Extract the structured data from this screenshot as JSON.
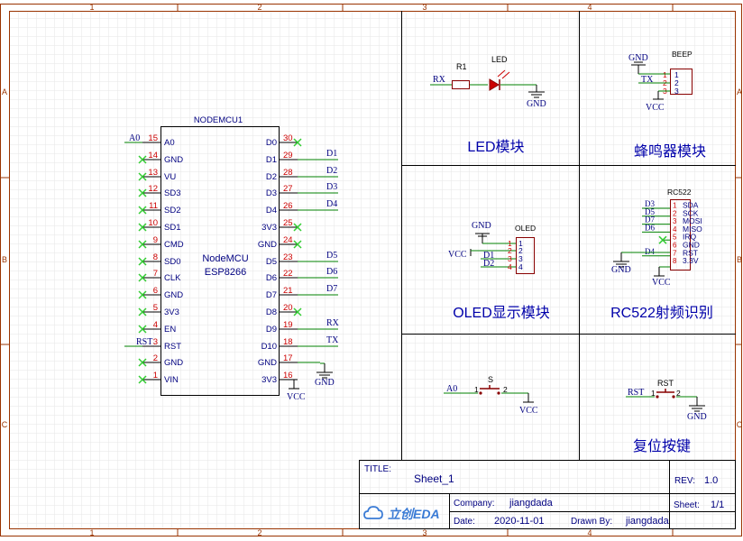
{
  "frame": {
    "cols": [
      "1",
      "2",
      "3",
      "4"
    ],
    "rows": [
      "A",
      "B",
      "C"
    ]
  },
  "sections": {
    "led": "LED模块",
    "buzzer": "蜂鸣器模块",
    "oled": "OLED显示模块",
    "rc522": "RC522射频识别",
    "reset": "复位按键"
  },
  "mcu": {
    "ref": "NODEMCU1",
    "name1": "NodeMCU",
    "name2": "ESP8266",
    "left_pins": [
      {
        "num": "15",
        "name": "A0",
        "net": "A0"
      },
      {
        "num": "14",
        "name": "GND",
        "net": ""
      },
      {
        "num": "13",
        "name": "VU",
        "net": ""
      },
      {
        "num": "12",
        "name": "SD3",
        "net": ""
      },
      {
        "num": "11",
        "name": "SD2",
        "net": ""
      },
      {
        "num": "10",
        "name": "SD1",
        "net": ""
      },
      {
        "num": "9",
        "name": "CMD",
        "net": ""
      },
      {
        "num": "8",
        "name": "SD0",
        "net": ""
      },
      {
        "num": "7",
        "name": "CLK",
        "net": ""
      },
      {
        "num": "6",
        "name": "GND",
        "net": ""
      },
      {
        "num": "5",
        "name": "3V3",
        "net": ""
      },
      {
        "num": "4",
        "name": "EN",
        "net": ""
      },
      {
        "num": "3",
        "name": "RST",
        "net": "RST"
      },
      {
        "num": "2",
        "name": "GND",
        "net": ""
      },
      {
        "num": "1",
        "name": "VIN",
        "net": ""
      }
    ],
    "right_pins": [
      {
        "num": "30",
        "name": "D0",
        "net": ""
      },
      {
        "num": "29",
        "name": "D1",
        "net": "D1"
      },
      {
        "num": "28",
        "name": "D2",
        "net": "D2"
      },
      {
        "num": "27",
        "name": "D3",
        "net": "D3"
      },
      {
        "num": "26",
        "name": "D4",
        "net": "D4"
      },
      {
        "num": "25",
        "name": "3V3",
        "net": ""
      },
      {
        "num": "24",
        "name": "GND",
        "net": ""
      },
      {
        "num": "23",
        "name": "D5",
        "net": "D5"
      },
      {
        "num": "22",
        "name": "D6",
        "net": "D6"
      },
      {
        "num": "21",
        "name": "D7",
        "net": "D7"
      },
      {
        "num": "20",
        "name": "D8",
        "net": ""
      },
      {
        "num": "19",
        "name": "D9",
        "net": "RX"
      },
      {
        "num": "18",
        "name": "D10",
        "net": "TX"
      },
      {
        "num": "17",
        "name": "GND",
        "net": "GND"
      },
      {
        "num": "16",
        "name": "3V3",
        "net": "VCC"
      }
    ]
  },
  "led": {
    "net": "RX",
    "r_ref": "R1",
    "led_ref": "LED",
    "gnd": "GND"
  },
  "beep": {
    "ref": "BEEP",
    "gnd": "GND",
    "tx": "TX",
    "vcc": "VCC",
    "pins": [
      "1",
      "2",
      "3"
    ]
  },
  "oled": {
    "ref": "OLED",
    "gnd": "GND",
    "vcc": "VCC",
    "pins": [
      {
        "num": "1",
        "net": ""
      },
      {
        "num": "2",
        "net": ""
      },
      {
        "num": "3",
        "net": "D1"
      },
      {
        "num": "4",
        "net": "D2"
      }
    ]
  },
  "rc522": {
    "ref": "RC522",
    "gnd": "GND",
    "vcc": "VCC",
    "pins": [
      {
        "num": "1",
        "name": "SDA",
        "net": "D3"
      },
      {
        "num": "2",
        "name": "SCK",
        "net": "D5"
      },
      {
        "num": "3",
        "name": "MOSI",
        "net": "D7"
      },
      {
        "num": "4",
        "name": "MISO",
        "net": "D6"
      },
      {
        "num": "5",
        "name": "IRQ",
        "net": ""
      },
      {
        "num": "6",
        "name": "GND",
        "net": ""
      },
      {
        "num": "7",
        "name": "RST",
        "net": "D4"
      },
      {
        "num": "8",
        "name": "3.3V",
        "net": ""
      }
    ]
  },
  "switch_s": {
    "ref": "S",
    "net": "A0",
    "p1": "1",
    "p2": "2",
    "vcc": "VCC"
  },
  "switch_rst": {
    "ref": "RST",
    "net": "RST",
    "p1": "1",
    "p2": "2",
    "gnd": "GND"
  },
  "titleblock": {
    "title_label": "TITLE:",
    "title": "Sheet_1",
    "rev_label": "REV:",
    "rev": "1.0",
    "company_label": "Company:",
    "company": "jiangdada",
    "sheet_label": "Sheet:",
    "sheet": "1/1",
    "date_label": "Date:",
    "date": "2020-11-01",
    "drawn_label": "Drawn By:",
    "drawn": "jiangdada",
    "logo": "立创EDA"
  },
  "colors": {
    "frame": "#993300",
    "wire": "#008000",
    "body": "#880000",
    "net": "#000080",
    "pin_num": "#cc0000",
    "noconnect": "#33cc33",
    "title": "#0000aa",
    "grid": "#e8e8e8"
  }
}
